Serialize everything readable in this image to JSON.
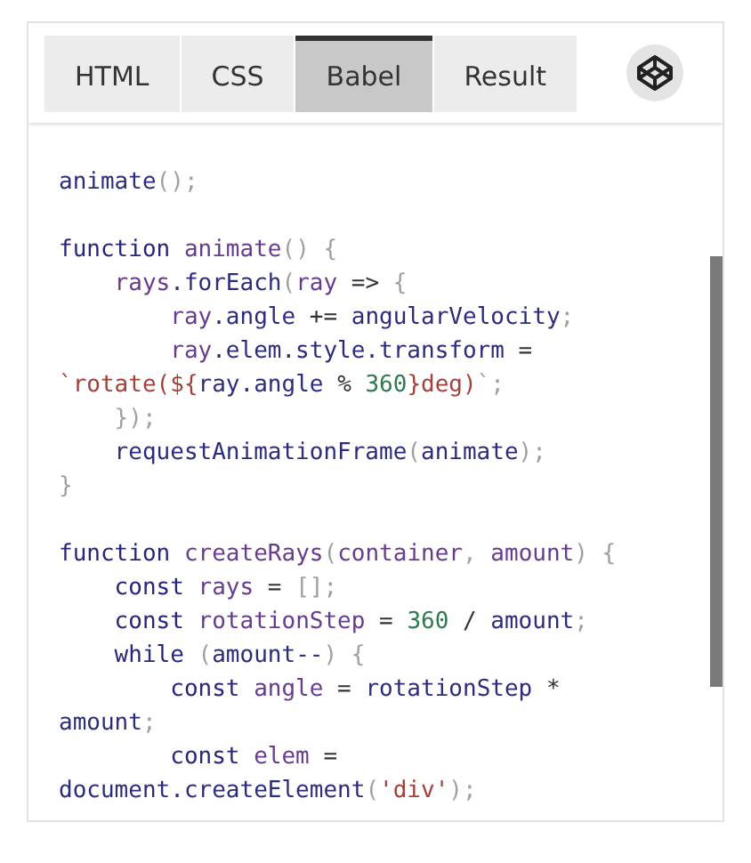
{
  "tabs": [
    {
      "label": "HTML",
      "selected": false
    },
    {
      "label": "CSS",
      "selected": false
    },
    {
      "label": "Babel",
      "selected": true
    },
    {
      "label": "Result",
      "selected": false
    }
  ],
  "code": {
    "lines": [
      {
        "kind": "code",
        "tokens": [
          {
            "text": "animate",
            "kind": "prop"
          },
          {
            "text": "();",
            "kind": "punct"
          }
        ]
      },
      {
        "kind": "blank"
      },
      {
        "kind": "code",
        "tokens": [
          {
            "text": "function ",
            "kind": "keyword"
          },
          {
            "text": "animate",
            "kind": "variable"
          },
          {
            "text": "() {",
            "kind": "punct"
          }
        ]
      },
      {
        "kind": "code",
        "tokens": [
          {
            "text": "    rays",
            "kind": "variable"
          },
          {
            "text": ".forEach",
            "kind": "prop"
          },
          {
            "text": "(",
            "kind": "punct"
          },
          {
            "text": "ray",
            "kind": "variable"
          },
          {
            "text": " => ",
            "kind": "plain"
          },
          {
            "text": "{",
            "kind": "punct"
          }
        ]
      },
      {
        "kind": "code",
        "tokens": [
          {
            "text": "        ray",
            "kind": "variable"
          },
          {
            "text": ".angle ",
            "kind": "prop"
          },
          {
            "text": "+= ",
            "kind": "plain"
          },
          {
            "text": "angularVelocity",
            "kind": "prop"
          },
          {
            "text": ";",
            "kind": "punct"
          }
        ]
      },
      {
        "kind": "code",
        "tokens": [
          {
            "text": "        ray",
            "kind": "variable"
          },
          {
            "text": ".elem.style.transform ",
            "kind": "prop"
          },
          {
            "text": "=",
            "kind": "plain"
          }
        ]
      },
      {
        "kind": "code",
        "tokens": [
          {
            "text": "`rotate(${",
            "kind": "string"
          },
          {
            "text": "ray.angle ",
            "kind": "prop"
          },
          {
            "text": "% ",
            "kind": "plain"
          },
          {
            "text": "360",
            "kind": "number"
          },
          {
            "text": "}deg)",
            "kind": "string"
          },
          {
            "text": "`;",
            "kind": "punct"
          }
        ]
      },
      {
        "kind": "code",
        "tokens": [
          {
            "text": "    });",
            "kind": "punct"
          }
        ]
      },
      {
        "kind": "code",
        "tokens": [
          {
            "text": "    requestAnimationFrame",
            "kind": "prop"
          },
          {
            "text": "(",
            "kind": "punct"
          },
          {
            "text": "animate",
            "kind": "prop"
          },
          {
            "text": ");",
            "kind": "punct"
          }
        ]
      },
      {
        "kind": "code",
        "tokens": [
          {
            "text": "}",
            "kind": "punct"
          }
        ]
      },
      {
        "kind": "blank"
      },
      {
        "kind": "code",
        "tokens": [
          {
            "text": "function ",
            "kind": "keyword"
          },
          {
            "text": "createRays",
            "kind": "variable"
          },
          {
            "text": "(",
            "kind": "punct"
          },
          {
            "text": "container",
            "kind": "variable"
          },
          {
            "text": ", ",
            "kind": "punct"
          },
          {
            "text": "amount",
            "kind": "variable"
          },
          {
            "text": ") {",
            "kind": "punct"
          }
        ]
      },
      {
        "kind": "code",
        "tokens": [
          {
            "text": "    const ",
            "kind": "keyword"
          },
          {
            "text": "rays ",
            "kind": "variable"
          },
          {
            "text": "= ",
            "kind": "plain"
          },
          {
            "text": "[];",
            "kind": "punct"
          }
        ]
      },
      {
        "kind": "code",
        "tokens": [
          {
            "text": "    const ",
            "kind": "keyword"
          },
          {
            "text": "rotationStep ",
            "kind": "variable"
          },
          {
            "text": "= ",
            "kind": "plain"
          },
          {
            "text": "360",
            "kind": "number"
          },
          {
            "text": " / ",
            "kind": "plain"
          },
          {
            "text": "amount",
            "kind": "prop"
          },
          {
            "text": ";",
            "kind": "punct"
          }
        ]
      },
      {
        "kind": "code",
        "tokens": [
          {
            "text": "    while ",
            "kind": "keyword"
          },
          {
            "text": "(",
            "kind": "punct"
          },
          {
            "text": "amount--",
            "kind": "prop"
          },
          {
            "text": ") {",
            "kind": "punct"
          }
        ]
      },
      {
        "kind": "code",
        "tokens": [
          {
            "text": "        const ",
            "kind": "keyword"
          },
          {
            "text": "angle ",
            "kind": "variable"
          },
          {
            "text": "= ",
            "kind": "plain"
          },
          {
            "text": "rotationStep ",
            "kind": "prop"
          },
          {
            "text": "*",
            "kind": "plain"
          }
        ]
      },
      {
        "kind": "code",
        "tokens": [
          {
            "text": "amount",
            "kind": "prop"
          },
          {
            "text": ";",
            "kind": "punct"
          }
        ]
      },
      {
        "kind": "code",
        "tokens": [
          {
            "text": "        const ",
            "kind": "keyword"
          },
          {
            "text": "elem ",
            "kind": "variable"
          },
          {
            "text": "=",
            "kind": "plain"
          }
        ]
      },
      {
        "kind": "code",
        "tokens": [
          {
            "text": "document.createElement",
            "kind": "prop"
          },
          {
            "text": "(",
            "kind": "punct"
          },
          {
            "text": "'div'",
            "kind": "string"
          },
          {
            "text": ");",
            "kind": "punct"
          }
        ]
      }
    ]
  }
}
